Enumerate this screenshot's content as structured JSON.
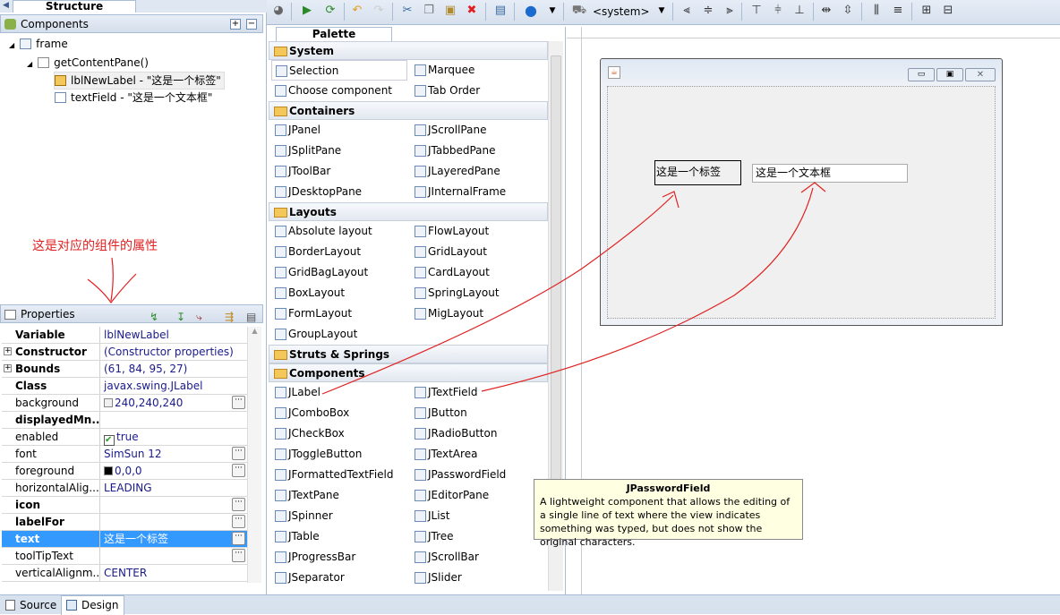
{
  "structure": {
    "tab_title": "Structure",
    "components_header": "Components",
    "tree": [
      {
        "label": "frame",
        "icon": "frame-icon"
      },
      {
        "label": "getContentPane()",
        "icon": "panel-icon"
      },
      {
        "label": "lblNewLabel - \"这是一个标签\"",
        "icon": "label-icon"
      },
      {
        "label": "textField - \"这是一个文本框\"",
        "icon": "textfield-icon"
      }
    ]
  },
  "annotation": {
    "text": "这是对应的组件的属性",
    "color": "#e02020"
  },
  "properties": {
    "title": "Properties",
    "rows": [
      {
        "k": "Variable",
        "v": "lblNewLabel",
        "bold": true
      },
      {
        "k": "Constructor",
        "v": "(Constructor properties)",
        "bold": true,
        "expand": true
      },
      {
        "k": "Bounds",
        "v": "(61, 84, 95, 27)",
        "bold": true,
        "expand": true
      },
      {
        "k": "Class",
        "v": "javax.swing.JLabel",
        "bold": true
      },
      {
        "k": "background",
        "v": "240,240,240",
        "swatch": "#f0f0f0",
        "dots": true
      },
      {
        "k": "displayedMn...",
        "v": "",
        "bold": true
      },
      {
        "k": "enabled",
        "v": "true",
        "check": true
      },
      {
        "k": "font",
        "v": "SimSun 12",
        "dots": true
      },
      {
        "k": "foreground",
        "v": "0,0,0",
        "swatch": "#000000",
        "dots": true
      },
      {
        "k": "horizontalAlig...",
        "v": "LEADING"
      },
      {
        "k": "icon",
        "v": "",
        "bold": true,
        "dots": true
      },
      {
        "k": "labelFor",
        "v": "",
        "bold": true,
        "dots": true
      },
      {
        "k": "text",
        "v": "这是一个标签",
        "bold": true,
        "dots": true,
        "selected": true
      },
      {
        "k": "toolTipText",
        "v": "",
        "dots": true
      },
      {
        "k": "verticalAlignm...",
        "v": "CENTER"
      }
    ]
  },
  "toolbar": {
    "locale": "<system>"
  },
  "palette": {
    "title": "Palette",
    "sections": [
      {
        "name": "System",
        "items": [
          "Selection",
          "Marquee",
          "Choose component",
          "Tab Order"
        ]
      },
      {
        "name": "Containers",
        "items": [
          "JPanel",
          "JScrollPane",
          "JSplitPane",
          "JTabbedPane",
          "JToolBar",
          "JLayeredPane",
          "JDesktopPane",
          "JInternalFrame"
        ]
      },
      {
        "name": "Layouts",
        "items": [
          "Absolute layout",
          "FlowLayout",
          "BorderLayout",
          "GridLayout",
          "GridBagLayout",
          "CardLayout",
          "BoxLayout",
          "SpringLayout",
          "FormLayout",
          "MigLayout",
          "GroupLayout"
        ]
      },
      {
        "name": "Struts & Springs",
        "items": []
      },
      {
        "name": "Components",
        "items": [
          "JLabel",
          "JTextField",
          "JComboBox",
          "JButton",
          "JCheckBox",
          "JRadioButton",
          "JToggleButton",
          "JTextArea",
          "JFormattedTextField",
          "JPasswordField",
          "JTextPane",
          "JEditorPane",
          "JSpinner",
          "JList",
          "JTable",
          "JTree",
          "JProgressBar",
          "JScrollBar",
          "JSeparator",
          "JSlider"
        ]
      }
    ]
  },
  "design": {
    "label_text": "这是一个标签",
    "textfield_value": "这是一个文本框"
  },
  "tooltip": {
    "title": "JPasswordField",
    "body": "A lightweight component that allows the editing of a single line of text where the view indicates something was typed, but does not show the original characters."
  },
  "bottom_tabs": [
    "Source",
    "Design"
  ]
}
